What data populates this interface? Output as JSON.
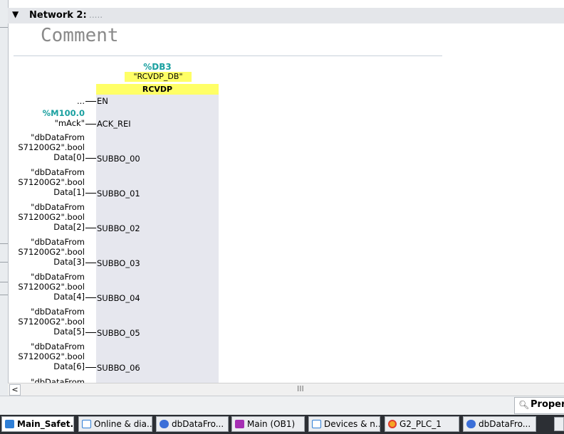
{
  "network": {
    "title": "Network 2:",
    "title_placeholder": ".....",
    "comment": "Comment"
  },
  "block": {
    "db_address": "%DB3",
    "db_name": "\"RCVDP_DB\"",
    "type": "RCVDP",
    "pins": {
      "en": "EN",
      "ack": "ACK_REI",
      "subbo": [
        "SUBBO_00",
        "SUBBO_01",
        "SUBBO_02",
        "SUBBO_03",
        "SUBBO_04",
        "SUBBO_05",
        "SUBBO_06"
      ]
    }
  },
  "operands": {
    "en_value": "...",
    "ack_address": "%M100.0",
    "ack_tag": "\"mAck\"",
    "data_line1": "\"dbDataFrom",
    "data_line2": "S71200G2\".bool",
    "data_index": [
      "Data[0]",
      "Data[1]",
      "Data[2]",
      "Data[3]",
      "Data[4]",
      "Data[5]",
      "Data[6]"
    ],
    "partial": "\"dbDataFrom"
  },
  "scrollbar": {
    "left_arrow": "<",
    "grip": "III"
  },
  "properties": {
    "label": "Proper"
  },
  "taskbar": {
    "items": [
      {
        "label": "Main_Safet...",
        "icon": "program-block-icon",
        "active": true
      },
      {
        "label": "Online & dia...",
        "icon": "diagnostics-icon",
        "active": false
      },
      {
        "label": "dbDataFro...",
        "icon": "data-block-icon",
        "active": false
      },
      {
        "label": "Main (OB1)",
        "icon": "organization-block-icon",
        "active": false
      },
      {
        "label": "Devices & n...",
        "icon": "network-icon",
        "active": false
      },
      {
        "label": "G2_PLC_1",
        "icon": "plc-status-icon",
        "active": false
      },
      {
        "label": "dbDataFro...",
        "icon": "data-block-icon",
        "active": false
      }
    ]
  },
  "colors": {
    "address": "#1aa0a0",
    "highlight": "#ffff66",
    "block_body": "#e6e7ee"
  }
}
